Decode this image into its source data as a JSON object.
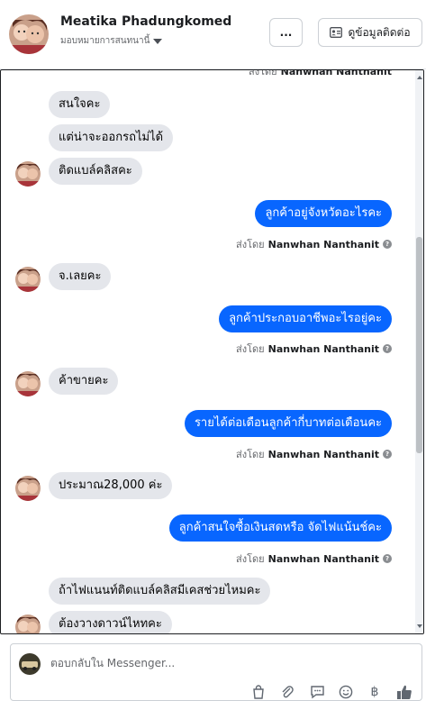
{
  "header": {
    "name": "Meatika Phadungkomed",
    "assign_label": "มอบหมายการสนทนานี้",
    "more_label": "...",
    "details_label": "ดูข้อมูลติดต่อ"
  },
  "chat": {
    "partial_top": {
      "prefix": "ส่งโดย",
      "name": "Nanwhan Nanthanit"
    },
    "messages": [
      {
        "from": "customer",
        "text": "สนใจคะ"
      },
      {
        "from": "customer",
        "text": "แต่น่าจะออกรถไม่ได้"
      },
      {
        "from": "customer",
        "text": "ติดแบล์คลิสคะ"
      },
      {
        "from": "page",
        "text": "ลูกค้าอยู่จังหวัดอะไรคะ",
        "sent_by_prefix": "ส่งโดย",
        "sent_by": "Nanwhan Nanthanit"
      },
      {
        "from": "customer",
        "text": "จ.เลยคะ"
      },
      {
        "from": "page",
        "text": "ลูกค้าประกอบอาชีพอะไรอยู่คะ",
        "sent_by_prefix": "ส่งโดย",
        "sent_by": "Nanwhan Nanthanit"
      },
      {
        "from": "customer",
        "text": "ค้าขายคะ"
      },
      {
        "from": "page",
        "text": "รายได้ต่อเดือนลูกค้ากี่บาทต่อเดือนคะ",
        "sent_by_prefix": "ส่งโดย",
        "sent_by": "Nanwhan Nanthanit"
      },
      {
        "from": "customer",
        "text": "ประมาณ28,000 ค่ะ"
      },
      {
        "from": "page",
        "text": "ลูกค้าสนใจซื้อเงินสดหรือ จัดไฟแน้นช์คะ",
        "sent_by_prefix": "ส่งโดย",
        "sent_by": "Nanwhan Nanthanit"
      },
      {
        "from": "customer",
        "text": "ถ้าไฟแนนท์ติดแบล์คลิสมีเคสช่วยไหมคะ"
      },
      {
        "from": "customer",
        "text": "ต้องวางดาวน์ไหทคะ"
      }
    ]
  },
  "composer": {
    "placeholder": "ตอบกลับใน Messenger...",
    "tools": [
      "shopping-bag-icon",
      "paperclip-icon",
      "quick-replies-icon",
      "emoji-icon",
      "baht-icon",
      "thumbs-up-icon"
    ]
  },
  "colors": {
    "accent": "#0866ff",
    "incoming_bubble": "#e4e6eb"
  }
}
